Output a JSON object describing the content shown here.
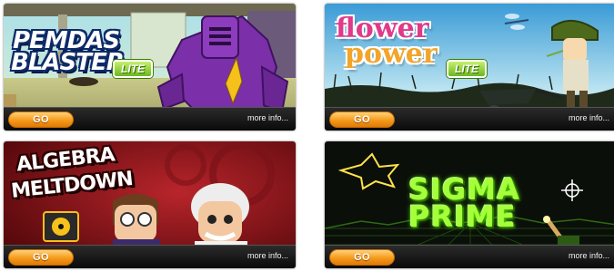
{
  "games": [
    {
      "title_lines": [
        "PEMDAS",
        "BLASTER"
      ],
      "badge": "LITE",
      "go_label": "GO",
      "more_label": "more info...",
      "icon": "purple-robot-character"
    },
    {
      "title_lines": [
        "flower",
        "power"
      ],
      "badge": "LITE",
      "go_label": "GO",
      "more_label": "more info...",
      "icon": "gardener-with-wheelbarrow"
    },
    {
      "title_lines": [
        "ALGEBRA",
        "MELTDOWN"
      ],
      "badge": "",
      "go_label": "GO",
      "more_label": "more info...",
      "icon": "scientist-characters"
    },
    {
      "title_lines": [
        "SIGMA",
        "PRIME"
      ],
      "badge": "",
      "go_label": "GO",
      "more_label": "more info...",
      "icon": "neon-crosshair-cannon"
    }
  ],
  "colors": {
    "go_button": "#f59a1a",
    "bar": "#111111",
    "lite_badge": "#7cc62a",
    "sigma_neon": "#a7ff3a"
  }
}
